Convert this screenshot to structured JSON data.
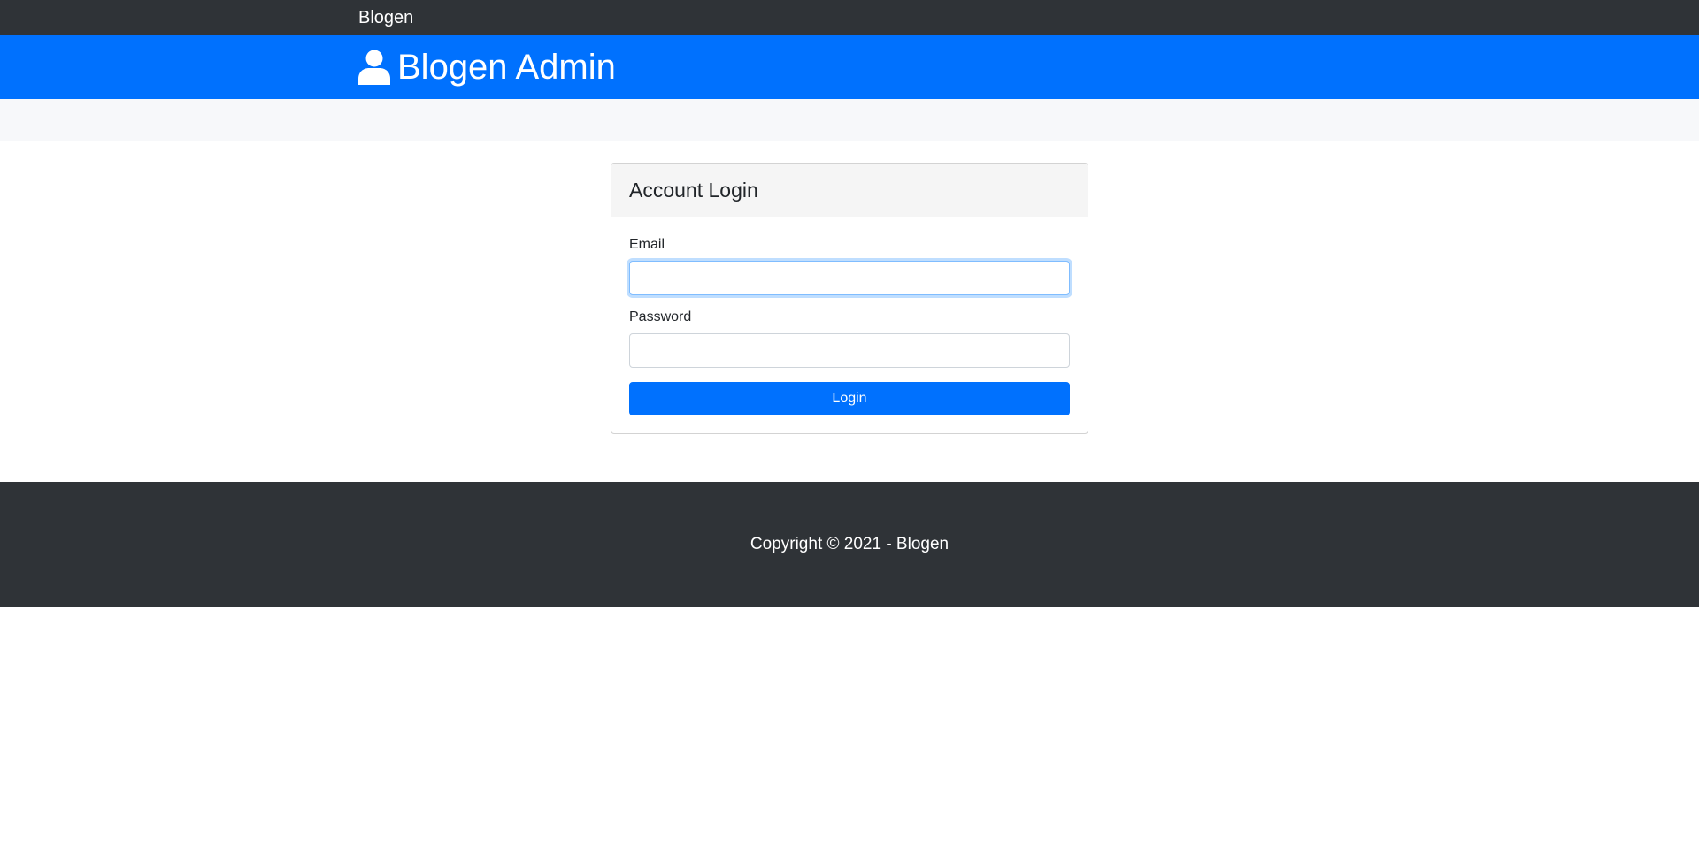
{
  "navbar": {
    "brand": "Blogen"
  },
  "header": {
    "icon": "user-icon",
    "title": "Blogen Admin"
  },
  "login": {
    "title": "Account Login",
    "email_label": "Email",
    "email_value": "",
    "password_label": "Password",
    "password_value": "",
    "button_label": "Login"
  },
  "footer": {
    "text": "Copyright © 2021 - Blogen"
  },
  "colors": {
    "navbar_bg": "#2f3337",
    "primary": "#0071fe",
    "band_bg": "#f7f8fa"
  }
}
